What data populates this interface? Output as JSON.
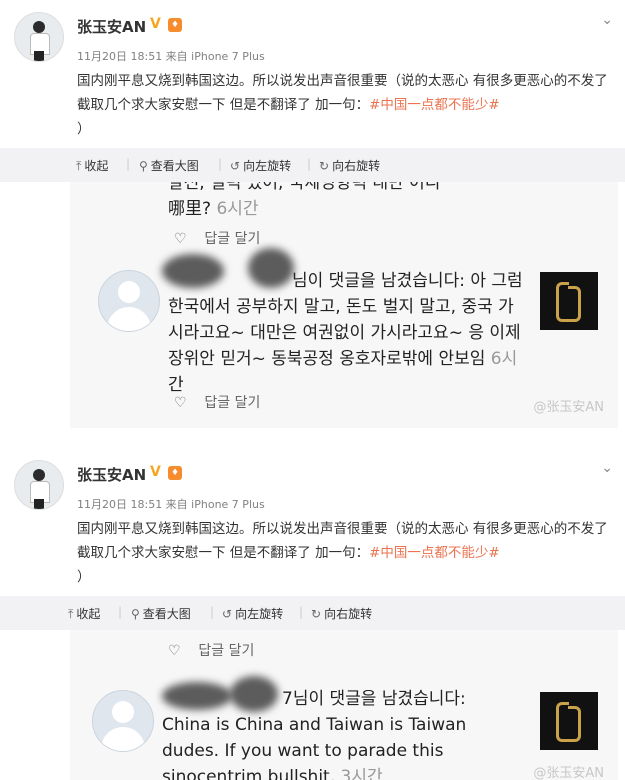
{
  "posts": [
    {
      "username": "张玉安AN",
      "verified_mark": "V",
      "meta": "11月20日 18:51 来自 iPhone 7 Plus",
      "text": "国内刚平息又烧到韩国这边。所以说发出声音很重要（说的太恶心 有很多更恶心的不发了 截取几个求大家安慰一下 但是不翻译了 加一句：",
      "hashtag": "#中国一点都不能少#",
      "text_end": "）",
      "toolbar": {
        "collect": "收起",
        "view_large": "查看大图",
        "rotate_left": "向左旋转",
        "rotate_right": "向右旋转"
      },
      "image": {
        "top_line1": "발전, 실력 있어, 국제영향력 대만 어디",
        "top_line2": "哪里?",
        "top_time": "6시간",
        "reply": "답글 달기",
        "comment_line1": "님이 댓글을 남겼습니다: 아 그럼",
        "comment_line2": "한국에서 공부하지 말고, 돈도 벌지 말고, 중국 가",
        "comment_line3": "시라고요~ 대만은 여권없이 가시라고요~ 응 이제",
        "comment_line4": "장위안 믿거~ 동북공정 옹호자로밖에 안보임",
        "comment_time": "6시",
        "comment_time2": "간",
        "reply2": "답글 달기",
        "watermark": "@张玉安AN"
      }
    },
    {
      "username": "张玉安AN",
      "verified_mark": "V",
      "meta": "11月20日 18:51 来自 iPhone 7 Plus",
      "text": "国内刚平息又烧到韩国这边。所以说发出声音很重要（说的太恶心 有很多更恶心的不发了 截取几个求大家安慰一下 但是不翻译了 加一句：",
      "hashtag": "#中国一点都不能少#",
      "text_end": "）",
      "toolbar": {
        "collect": "收起",
        "view_large": "查看大图",
        "rotate_left": "向左旋转",
        "rotate_right": "向右旋转"
      },
      "image": {
        "reply": "답글 달기",
        "comment_line1": "7님이 댓글을 남겼습니다:",
        "comment_line2": "China is China and Taiwan is Taiwan",
        "comment_line3": "dudes. If you want to parade this",
        "comment_line4": "sinocentrim bullshit,",
        "comment_time": "3시간",
        "watermark": "@张玉安AN"
      }
    }
  ],
  "colors": {
    "link": "#eb7350",
    "badge_v": "#f5a623",
    "toolbar_bg": "#f2f2f5"
  }
}
